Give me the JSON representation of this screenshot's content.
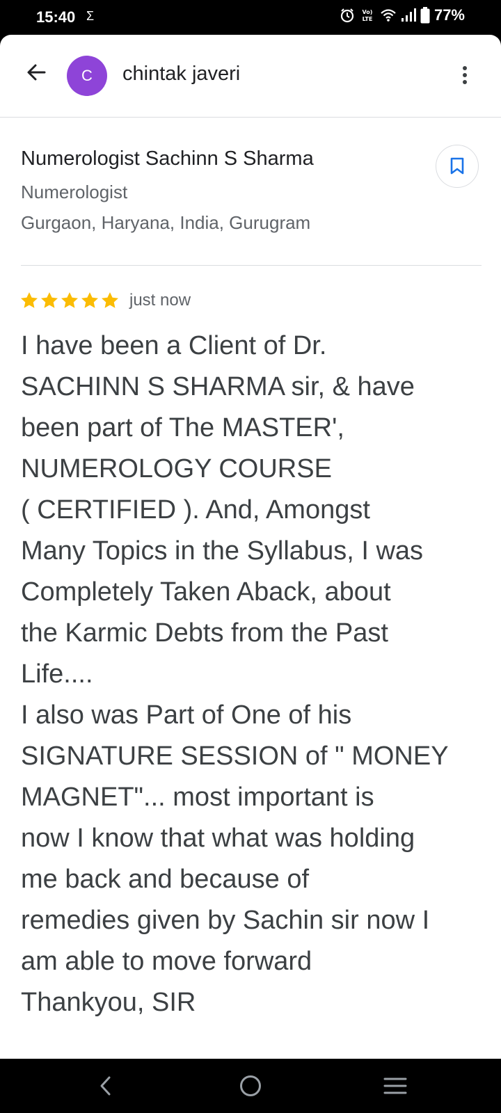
{
  "status_bar": {
    "time": "15:40",
    "notification_glyph": "Σ",
    "battery_percent": "77%",
    "icons": [
      "alarm-icon",
      "volte-icon",
      "wifi-icon",
      "signal-icon",
      "battery-icon"
    ]
  },
  "app_bar": {
    "avatar_letter": "C",
    "avatar_color": "#8e44d8",
    "user_name": "chintak javeri"
  },
  "place": {
    "name": "Numerologist Sachinn S Sharma",
    "category": "Numerologist",
    "address": "Gurgaon, Haryana, India, Gurugram"
  },
  "review": {
    "rating": 5,
    "max_rating": 5,
    "star_color": "#fbbc04",
    "time": "just now",
    "text": "I have been a Client of Dr.\nSACHINN S SHARMA sir, & have\nbeen part of The MASTER',\nNUMEROLOGY COURSE\n( CERTIFIED ). And, Amongst\nMany Topics in the Syllabus, I was\nCompletely Taken Aback, about\nthe Karmic Debts from the Past\nLife....\nI also was Part of One of his\nSIGNATURE SESSION of \" MONEY\nMAGNET\"... most important is\nnow I know that what was holding\nme back and because of\nremedies given by Sachin sir now I\nam able to move forward\nThankyou, SIR"
  },
  "colors": {
    "accent": "#1a73e8",
    "text_primary": "#202124",
    "text_secondary": "#5f6368"
  }
}
